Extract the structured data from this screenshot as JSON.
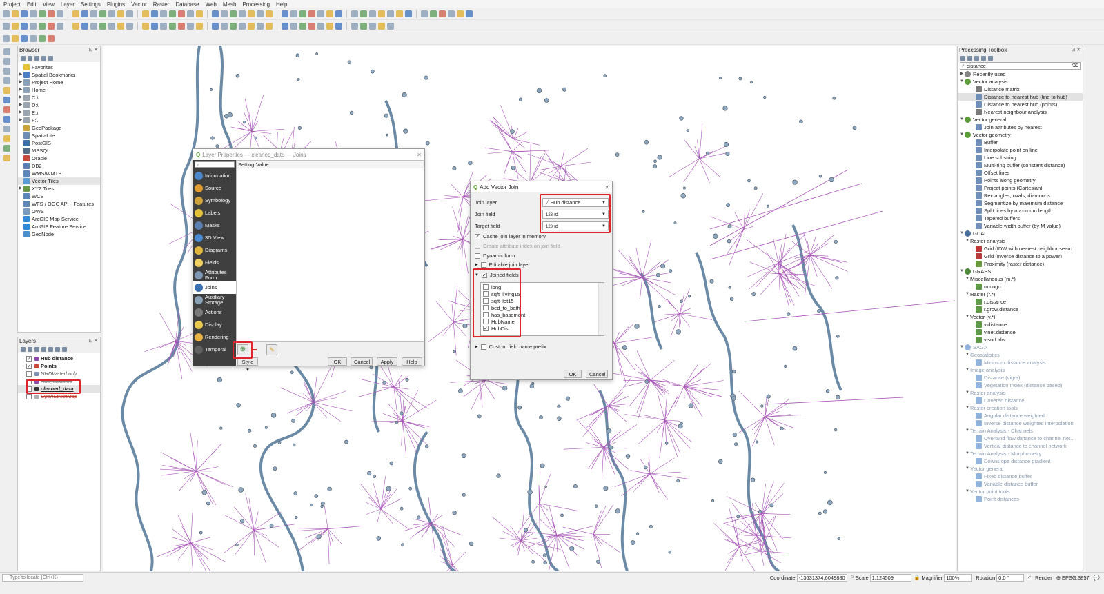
{
  "menubar": [
    "Project",
    "Edit",
    "View",
    "Layer",
    "Settings",
    "Plugins",
    "Vector",
    "Raster",
    "Database",
    "Web",
    "Mesh",
    "Processing",
    "Help"
  ],
  "browser": {
    "title": "Browser",
    "items": [
      {
        "label": "Favorites",
        "color": "#e8c13a",
        "arrow": ""
      },
      {
        "label": "Spatial Bookmarks",
        "color": "#4e7ec4",
        "arrow": "▶"
      },
      {
        "label": "Project Home",
        "color": "#8aa1b7",
        "arrow": "▶"
      },
      {
        "label": "Home",
        "color": "#8aa1b7",
        "arrow": "▶"
      },
      {
        "label": "C:\\",
        "color": "#9aa5af",
        "arrow": "▶"
      },
      {
        "label": "D:\\",
        "color": "#9aa5af",
        "arrow": "▶"
      },
      {
        "label": "E:\\",
        "color": "#9aa5af",
        "arrow": "▶"
      },
      {
        "label": "F:\\",
        "color": "#9aa5af",
        "arrow": "▶"
      },
      {
        "label": "GeoPackage",
        "color": "#c9a23b",
        "arrow": ""
      },
      {
        "label": "SpatiaLite",
        "color": "#6d8fb4",
        "arrow": ""
      },
      {
        "label": "PostGIS",
        "color": "#3a6fa8",
        "arrow": ""
      },
      {
        "label": "MSSQL",
        "color": "#556e8a",
        "arrow": ""
      },
      {
        "label": "Oracle",
        "color": "#c74b3b",
        "arrow": ""
      },
      {
        "label": "DB2",
        "color": "#5b7fb1",
        "arrow": ""
      },
      {
        "label": "WMS/WMTS",
        "color": "#5c86b5",
        "arrow": ""
      },
      {
        "label": "Vector Tiles",
        "color": "#5b9bd5",
        "arrow": ""
      },
      {
        "label": "XYZ Tiles",
        "color": "#6b9a4b",
        "arrow": "▶"
      },
      {
        "label": "WCS",
        "color": "#5c86b5",
        "arrow": ""
      },
      {
        "label": "WFS / OGC API - Features",
        "color": "#5c86b5",
        "arrow": ""
      },
      {
        "label": "OWS",
        "color": "#7a9bc0",
        "arrow": ""
      },
      {
        "label": "ArcGIS Map Service",
        "color": "#2f8ad6",
        "arrow": ""
      },
      {
        "label": "ArcGIS Feature Service",
        "color": "#2f8ad6",
        "arrow": ""
      },
      {
        "label": "GeoNode",
        "color": "#4b8fcf",
        "arrow": ""
      }
    ]
  },
  "layers": {
    "title": "Layers",
    "items": [
      {
        "label": "Hub distance",
        "checked": "✓",
        "style": "bold",
        "color": "#8e4aa8"
      },
      {
        "label": "Points",
        "checked": "✓",
        "style": "bold",
        "color": "#c8463a"
      },
      {
        "label": "NHDWaterbody",
        "checked": "",
        "style": "italic",
        "color": "#7c8fb0"
      },
      {
        "label": "Hub_distance",
        "checked": "",
        "style": "strike",
        "color": "#8e4aa8"
      },
      {
        "label": "cleaned_data",
        "checked": "",
        "style": "bolditalic",
        "color": "#333333"
      },
      {
        "label": "OpenStreetMap",
        "checked": "",
        "style": "strike",
        "color": "#b0b0b0"
      }
    ]
  },
  "toolbox": {
    "title": "Processing Toolbox",
    "search": "distance",
    "items": [
      {
        "label": "Recently used",
        "indent": 1,
        "arrow": "▶",
        "color": "#888888",
        "dim": false
      },
      {
        "label": "Vector analysis",
        "indent": 1,
        "arrow": "▼",
        "color": "#5c9c38",
        "dim": false
      },
      {
        "label": "Distance matrix",
        "indent": 3,
        "arrow": "",
        "color": "#7a7a7a",
        "dim": false
      },
      {
        "label": "Distance to nearest hub (line to hub)",
        "indent": 3,
        "arrow": "",
        "color": "#6f8fb8",
        "dim": false,
        "highlight": true
      },
      {
        "label": "Distance to nearest hub (points)",
        "indent": 3,
        "arrow": "",
        "color": "#6f8fb8",
        "dim": false
      },
      {
        "label": "Nearest neighbour analysis",
        "indent": 3,
        "arrow": "",
        "color": "#7a7a7a",
        "dim": false
      },
      {
        "label": "Vector general",
        "indent": 1,
        "arrow": "▼",
        "color": "#5c9c38",
        "dim": false
      },
      {
        "label": "Join attributes by nearest",
        "indent": 3,
        "arrow": "",
        "color": "#6f8fb8",
        "dim": false
      },
      {
        "label": "Vector geometry",
        "indent": 1,
        "arrow": "▼",
        "color": "#5c9c38",
        "dim": false
      },
      {
        "label": "Buffer",
        "indent": 3,
        "arrow": "",
        "color": "#6f8fb8",
        "dim": false
      },
      {
        "label": "Interpolate point on line",
        "indent": 3,
        "arrow": "",
        "color": "#6f8fb8",
        "dim": false
      },
      {
        "label": "Line substring",
        "indent": 3,
        "arrow": "",
        "color": "#6f8fb8",
        "dim": false
      },
      {
        "label": "Multi-ring buffer (constant distance)",
        "indent": 3,
        "arrow": "",
        "color": "#6f8fb8",
        "dim": false
      },
      {
        "label": "Offset lines",
        "indent": 3,
        "arrow": "",
        "color": "#6f8fb8",
        "dim": false
      },
      {
        "label": "Points along geometry",
        "indent": 3,
        "arrow": "",
        "color": "#6f8fb8",
        "dim": false
      },
      {
        "label": "Project points (Cartesian)",
        "indent": 3,
        "arrow": "",
        "color": "#6f8fb8",
        "dim": false
      },
      {
        "label": "Rectangles, ovals, diamonds",
        "indent": 3,
        "arrow": "",
        "color": "#6f8fb8",
        "dim": false
      },
      {
        "label": "Segmentize by maximum distance",
        "indent": 3,
        "arrow": "",
        "color": "#6f8fb8",
        "dim": false
      },
      {
        "label": "Split lines by maximum length",
        "indent": 3,
        "arrow": "",
        "color": "#6f8fb8",
        "dim": false
      },
      {
        "label": "Tapered buffers",
        "indent": 3,
        "arrow": "",
        "color": "#6f8fb8",
        "dim": false
      },
      {
        "label": "Variable width buffer (by M value)",
        "indent": 3,
        "arrow": "",
        "color": "#6f8fb8",
        "dim": false
      },
      {
        "label": "GDAL",
        "indent": 1,
        "arrow": "▼",
        "color": "#4a6f9e",
        "dim": false
      },
      {
        "label": "Raster analysis",
        "indent": 2,
        "arrow": "▼",
        "color": "",
        "dim": false
      },
      {
        "label": "Grid (IDW with nearest neighbor searc...",
        "indent": 3,
        "arrow": "",
        "color": "#b83a3a",
        "dim": false
      },
      {
        "label": "Grid (Inverse distance to a power)",
        "indent": 3,
        "arrow": "",
        "color": "#b83a3a",
        "dim": false
      },
      {
        "label": "Proximity (raster distance)",
        "indent": 3,
        "arrow": "",
        "color": "#6a9a3b",
        "dim": false
      },
      {
        "label": "GRASS",
        "indent": 1,
        "arrow": "▼",
        "color": "#4f8a3a",
        "dim": false
      },
      {
        "label": "Miscellaneous (m.*)",
        "indent": 2,
        "arrow": "▼",
        "color": "",
        "dim": false
      },
      {
        "label": "m.cogo",
        "indent": 3,
        "arrow": "",
        "color": "#5f9a4a",
        "dim": false
      },
      {
        "label": "Raster (r.*)",
        "indent": 2,
        "arrow": "▼",
        "color": "",
        "dim": false
      },
      {
        "label": "r.distance",
        "indent": 3,
        "arrow": "",
        "color": "#5f9a4a",
        "dim": false
      },
      {
        "label": "r.grow.distance",
        "indent": 3,
        "arrow": "",
        "color": "#5f9a4a",
        "dim": false
      },
      {
        "label": "Vector (v.*)",
        "indent": 2,
        "arrow": "▼",
        "color": "",
        "dim": false
      },
      {
        "label": "v.distance",
        "indent": 3,
        "arrow": "",
        "color": "#5f9a4a",
        "dim": false
      },
      {
        "label": "v.net.distance",
        "indent": 3,
        "arrow": "",
        "color": "#5f9a4a",
        "dim": false
      },
      {
        "label": "v.surf.idw",
        "indent": 3,
        "arrow": "",
        "color": "#5f9a4a",
        "dim": false
      },
      {
        "label": "SAGA",
        "indent": 1,
        "arrow": "▼",
        "color": "#3a77c0",
        "dim": true
      },
      {
        "label": "Geostatistics",
        "indent": 2,
        "arrow": "▼",
        "color": "",
        "dim": true
      },
      {
        "label": "Minimum distance analysis",
        "indent": 3,
        "arrow": "",
        "color": "#3a77c0",
        "dim": true
      },
      {
        "label": "Image analysis",
        "indent": 2,
        "arrow": "▼",
        "color": "",
        "dim": true
      },
      {
        "label": "Distance (vigra)",
        "indent": 3,
        "arrow": "",
        "color": "#3a77c0",
        "dim": true
      },
      {
        "label": "Vegetation Index (distance based)",
        "indent": 3,
        "arrow": "",
        "color": "#3a77c0",
        "dim": true
      },
      {
        "label": "Raster analysis",
        "indent": 2,
        "arrow": "▼",
        "color": "",
        "dim": true
      },
      {
        "label": "Covered distance",
        "indent": 3,
        "arrow": "",
        "color": "#3a77c0",
        "dim": true
      },
      {
        "label": "Raster creation tools",
        "indent": 2,
        "arrow": "▼",
        "color": "",
        "dim": true
      },
      {
        "label": "Angular distance weighted",
        "indent": 3,
        "arrow": "",
        "color": "#3a77c0",
        "dim": true
      },
      {
        "label": "Inverse distance weighted interpolation",
        "indent": 3,
        "arrow": "",
        "color": "#3a77c0",
        "dim": true
      },
      {
        "label": "Terrain Analysis - Channels",
        "indent": 2,
        "arrow": "▼",
        "color": "",
        "dim": true
      },
      {
        "label": "Overland flow distance to channel net...",
        "indent": 3,
        "arrow": "",
        "color": "#3a77c0",
        "dim": true
      },
      {
        "label": "Vertical distance to channel network",
        "indent": 3,
        "arrow": "",
        "color": "#3a77c0",
        "dim": true
      },
      {
        "label": "Terrain Analysis - Morphometry",
        "indent": 2,
        "arrow": "▼",
        "color": "",
        "dim": true
      },
      {
        "label": "Downslope distance gradient",
        "indent": 3,
        "arrow": "",
        "color": "#3a77c0",
        "dim": true
      },
      {
        "label": "Vector general",
        "indent": 2,
        "arrow": "▼",
        "color": "",
        "dim": true
      },
      {
        "label": "Fixed distance buffer",
        "indent": 3,
        "arrow": "",
        "color": "#3a77c0",
        "dim": true
      },
      {
        "label": "Variable distance buffer",
        "indent": 3,
        "arrow": "",
        "color": "#3a77c0",
        "dim": true
      },
      {
        "label": "Vector point tools",
        "indent": 2,
        "arrow": "▼",
        "color": "",
        "dim": true
      },
      {
        "label": "Point distances",
        "indent": 3,
        "arrow": "",
        "color": "#3a77c0",
        "dim": true
      }
    ]
  },
  "layer_props": {
    "title": "Layer Properties — cleaned_data — Joins",
    "columns": [
      "Setting",
      "Value"
    ],
    "sidebar": [
      {
        "label": "Information",
        "color": "#4a86c8"
      },
      {
        "label": "Source",
        "color": "#e29b2d"
      },
      {
        "label": "Symbology",
        "color": "#d2a23a"
      },
      {
        "label": "Labels",
        "color": "#e2c03a"
      },
      {
        "label": "Masks",
        "color": "#5a7fb0"
      },
      {
        "label": "3D View",
        "color": "#4b8ad0"
      },
      {
        "label": "Diagrams",
        "color": "#e0b53b"
      },
      {
        "label": "Fields",
        "color": "#f0d060"
      },
      {
        "label": "Attributes Form",
        "color": "#7d96b4"
      },
      {
        "label": "Joins",
        "color": "#3a6fb2",
        "active": true
      },
      {
        "label": "Auxiliary Storage",
        "color": "#8aa0b4"
      },
      {
        "label": "Actions",
        "color": "#7a7a7a"
      },
      {
        "label": "Display",
        "color": "#e8c850"
      },
      {
        "label": "Rendering",
        "color": "#e8b040"
      },
      {
        "label": "Temporal",
        "color": "#606060"
      }
    ],
    "style_label": "Style",
    "buttons": {
      "ok": "OK",
      "cancel": "Cancel",
      "apply": "Apply",
      "help": "Help"
    }
  },
  "add_join": {
    "title": "Add Vector Join",
    "join_layer_label": "Join layer",
    "join_layer_value": "Hub distance",
    "join_field_label": "Join field",
    "join_field_value": "id",
    "target_field_label": "Target field",
    "target_field_value": "id",
    "field_type_badge": "123",
    "cache_label": "Cache join layer in memory",
    "create_index_label": "Create attribute index on join field",
    "dynamic_form_label": "Dynamic form",
    "editable_label": "Editable join layer",
    "joined_fields_label": "Joined fields",
    "fields": [
      {
        "name": "long",
        "checked": ""
      },
      {
        "name": "sqft_living15",
        "checked": ""
      },
      {
        "name": "sqft_lot15",
        "checked": ""
      },
      {
        "name": "bed_to_bath",
        "checked": ""
      },
      {
        "name": "has_basement",
        "checked": ""
      },
      {
        "name": "HubName",
        "checked": ""
      },
      {
        "name": "HubDist",
        "checked": "✓"
      }
    ],
    "prefix_label": "Custom field name prefix",
    "ok": "OK",
    "cancel": "Cancel"
  },
  "status": {
    "locate_placeholder": "Type to locate (Ctrl+K)",
    "coordinate_label": "Coordinate",
    "coordinate_value": "-13631374,6049880",
    "scale_label": "Scale",
    "scale_value": "1:124509",
    "magnifier_label": "Magnifier",
    "magnifier_value": "100%",
    "rotation_label": "Rotation",
    "rotation_value": "0.0 °",
    "render_label": "Render",
    "crs": "EPSG:3857"
  },
  "colors": {
    "accent_red": "#e0242b",
    "map_line": "#6b8aa6",
    "map_rays": "#a654b5"
  }
}
